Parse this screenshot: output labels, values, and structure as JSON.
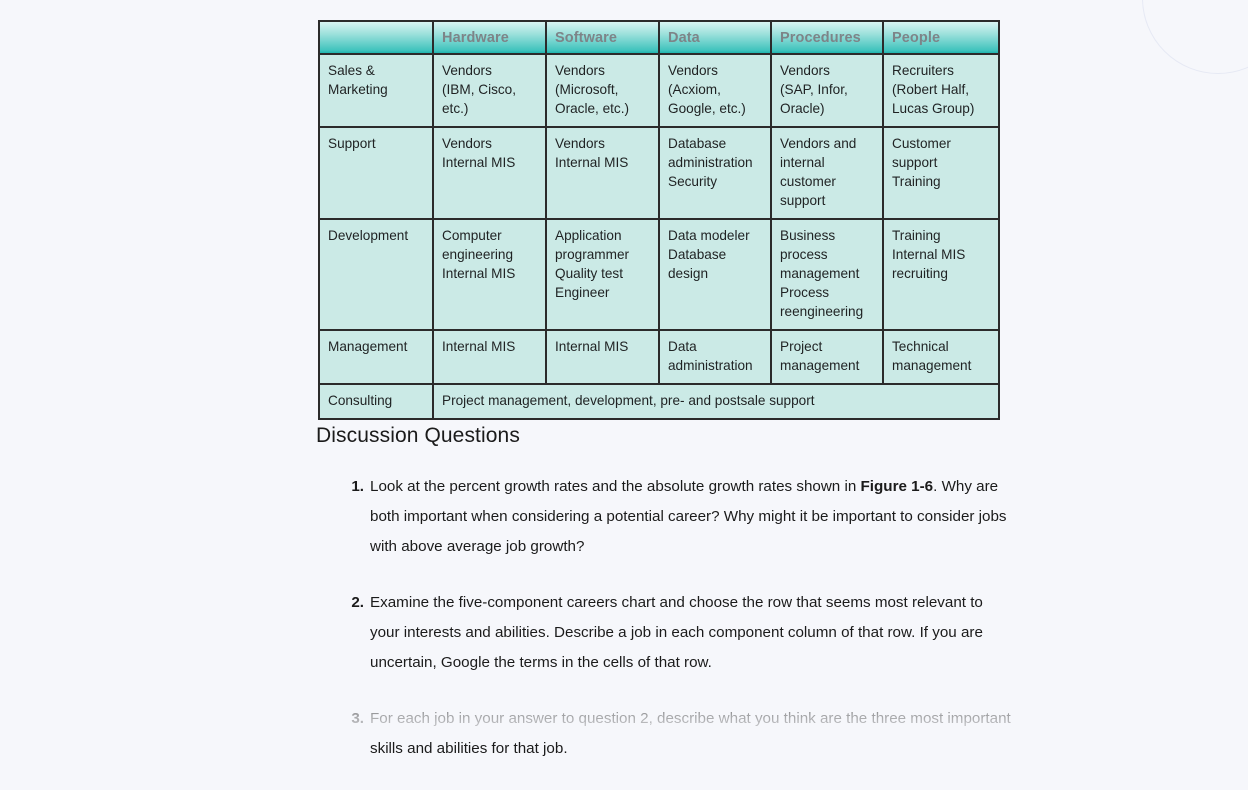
{
  "page": {
    "background_color": "#f6f7fb",
    "table_fill_color": "#cbeae6",
    "header_accent_color": "#3fc3bd",
    "header_text_color": "#7d8488",
    "border_color": "#2b2b2b"
  },
  "table": {
    "headers": [
      "",
      "Hardware",
      "Software",
      "Data",
      "Procedures",
      "People"
    ],
    "rows": [
      {
        "label": "Sales &\nMarketing",
        "cells": [
          "Vendors\n(IBM, Cisco,\netc.)",
          "Vendors\n(Microsoft,\nOracle, etc.)",
          "Vendors\n(Acxiom,\nGoogle, etc.)",
          "Vendors\n(SAP, Infor,\nOracle)",
          "Recruiters\n(Robert Half,\nLucas Group)"
        ]
      },
      {
        "label": "Support",
        "cells": [
          "Vendors\nInternal MIS",
          "Vendors\nInternal MIS",
          "Database\nadministration\nSecurity",
          "Vendors and\ninternal\ncustomer\nsupport",
          "Customer\nsupport\nTraining"
        ]
      },
      {
        "label": "Development",
        "cells": [
          "Computer\nengineering\nInternal MIS",
          "Application\nprogrammer\nQuality test\nEngineer",
          "Data modeler\nDatabase\ndesign",
          "Business\nprocess\nmanagement\nProcess\nreengineering",
          "Training\nInternal MIS\nrecruiting"
        ]
      },
      {
        "label": "Management",
        "cells": [
          "Internal MIS",
          "Internal MIS",
          "Data\nadministration",
          "Project\nmanagement",
          "Technical\nmanagement"
        ]
      }
    ],
    "consulting_row": {
      "label": "Consulting",
      "span_text": "Project management, development, pre- and postsale support"
    }
  },
  "discussion": {
    "heading": "Discussion Questions",
    "questions": [
      {
        "number": "1.",
        "parts": [
          {
            "text": "Look at the percent growth rates and the absolute growth rates shown in ",
            "bold": false
          },
          {
            "text": "Figure 1-6",
            "bold": true
          },
          {
            "text": ". Why are both important when considering a potential career? Why might it be important to consider jobs with above average job growth?",
            "bold": false
          }
        ]
      },
      {
        "number": "2.",
        "parts": [
          {
            "text": "Examine the five-component careers chart and choose the row that seems most relevant to your interests and abilities. Describe a job in each component column of that row. If you are uncertain, Google the terms in the cells of that row.",
            "bold": false
          }
        ]
      },
      {
        "number": "3.",
        "parts": [
          {
            "text": "For each job in your answer to question 2, describe what you think are the three most important skills and abilities for that job.",
            "bold": false
          }
        ]
      }
    ]
  }
}
